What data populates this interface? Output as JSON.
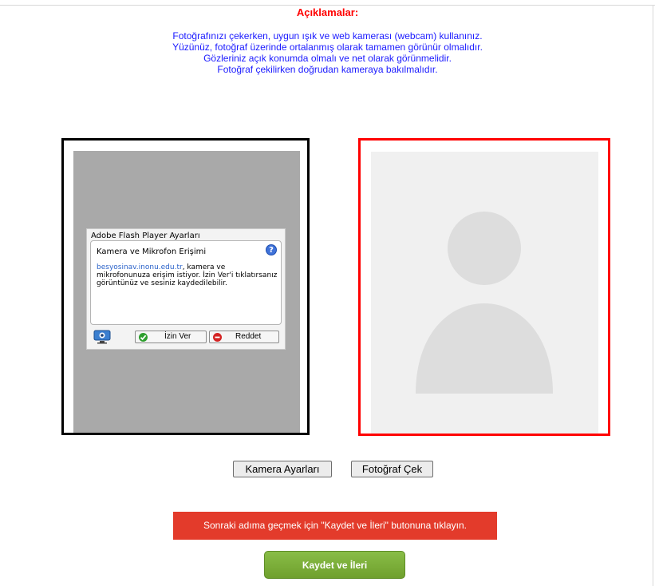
{
  "header": {
    "title": "Açıklamalar:",
    "instructions": [
      "Fotoğrafınızı çekerken, uygun ışık ve web kamerası (webcam) kullanınız.",
      "Yüzünüz, fotoğraf üzerinde ortalanmış olarak tamamen görünür olmalıdır.",
      "Gözleriniz açık konumda olmalı ve net olarak görünmelidir.",
      "Fotoğraf çekilirken doğrudan kameraya bakılmalıdır."
    ]
  },
  "flash_dialog": {
    "title": "Adobe Flash Player Ayarları",
    "heading": "Kamera ve Mikrofon Erişimi",
    "domain": "besyosinav.inonu.edu.tr",
    "message": ", kamera ve mikrofonunuza erişim istiyor. İzin Ver'i tıklatırsanız görüntünüz ve sesiniz kaydedilebilir.",
    "allow_label": "İzin Ver",
    "deny_label": "Reddet",
    "help_symbol": "?"
  },
  "controls": {
    "camera_settings_label": "Kamera Ayarları",
    "take_photo_label": "Fotoğraf Çek"
  },
  "notice": {
    "text": "Sonraki adıma geçmek için \"Kaydet ve İleri\" butonuna tıklayın."
  },
  "save_button": {
    "label": "Kaydet ve İleri"
  },
  "colors": {
    "title": "#ff0000",
    "instructions": "#1a1aff",
    "notice_bg": "#e33b2b",
    "save_bg": "#7aad35",
    "photo_border": "#ff0000",
    "camera_border": "#000000"
  },
  "icons": {
    "help": "help-icon",
    "camera": "webcam-icon",
    "allow": "check-icon",
    "deny": "minus-icon",
    "avatar": "user-silhouette-icon"
  }
}
